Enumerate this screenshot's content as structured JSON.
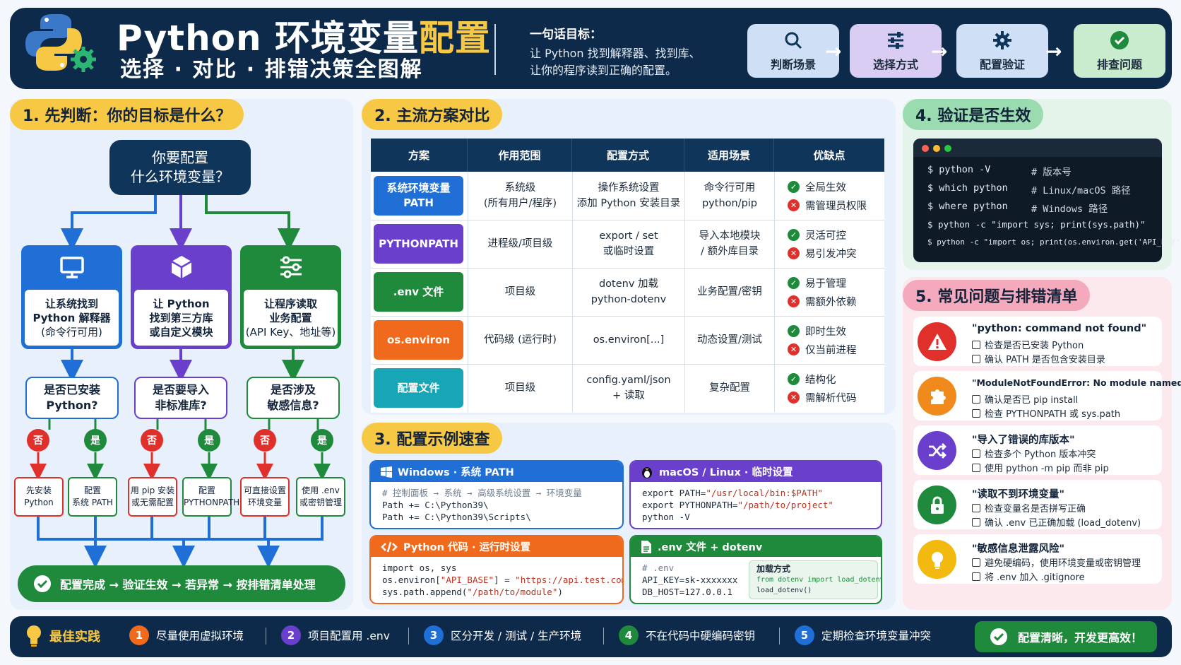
{
  "header": {
    "title_main": "Python 环境变量",
    "title_highlight": "配置",
    "subtitle": "选择 · 对比 · 排错决策全图解",
    "goal_title": "一句话目标：",
    "goal_lines": [
      "让 Python 找到解释器、找到库、",
      "让你的程序读到正确的配置。"
    ],
    "steps": [
      "判断场景",
      "选择方式",
      "配置验证",
      "排查问题"
    ],
    "arrow": "→"
  },
  "section1": {
    "title": "1. 先判断：你的目标是什么？",
    "root": [
      "你要配置",
      "什么环境变量？"
    ],
    "goals": [
      {
        "l1": "让系统找到",
        "l2": "Python 解释器",
        "l3": "(命令行可用)"
      },
      {
        "l1": "让 Python",
        "l2": "找到第三方库",
        "l3": "或自定义模块"
      },
      {
        "l1": "让程序读取",
        "l2": "业务配置",
        "l3": "(API Key、地址等)"
      }
    ],
    "questions": [
      [
        "是否已安装",
        "Python?"
      ],
      [
        "是否要导入",
        "非标准库?"
      ],
      [
        "是否涉及",
        "敏感信息?"
      ]
    ],
    "no": "否",
    "yes": "是",
    "leaves": [
      [
        "先安装",
        "Python"
      ],
      [
        "配置",
        "系统 PATH"
      ],
      [
        "用 pip 安装",
        "或无需配置"
      ],
      [
        "配置",
        "PYTHONPATH"
      ],
      [
        "可直接设置",
        "环境变量"
      ],
      [
        "使用 .env",
        "或密钥管理"
      ]
    ],
    "final": "配置完成 → 验证生效 → 若异常 → 按排错清单处理"
  },
  "section2": {
    "title": "2. 主流方案对比",
    "headers": [
      "方案",
      "作用范围",
      "配置方式",
      "适用场景",
      "优缺点"
    ],
    "rows": [
      {
        "tag1": "系统环境变量",
        "tag2": "PATH",
        "scope1": "系统级",
        "scope2": "(所有用户/程序)",
        "method1": "操作系统设置",
        "method2": "添加 Python 安装目录",
        "use1": "命令行可用",
        "use2": "python/pip",
        "pro": "全局生效",
        "con": "需管理员权限",
        "color": "#1f6fd6"
      },
      {
        "tag1": "PYTHONPATH",
        "tag2": "",
        "scope1": "进程级/项目级",
        "scope2": "",
        "method1": "export / set",
        "method2": "或临时设置",
        "use1": "导入本地模块",
        "use2": "/ 额外库目录",
        "pro": "灵活可控",
        "con": "易引发冲突",
        "color": "#6a3fcb"
      },
      {
        "tag1": ".env 文件",
        "tag2": "",
        "scope1": "项目级",
        "scope2": "",
        "method1": "dotenv 加载",
        "method2": "python-dotenv",
        "use1": "业务配置/密钥",
        "use2": "",
        "pro": "易于管理",
        "con": "需额外依赖",
        "color": "#1f8a3c"
      },
      {
        "tag1": "os.environ",
        "tag2": "",
        "scope1": "代码级 (运行时)",
        "scope2": "",
        "method1": "os.environ[...]",
        "method2": "",
        "use1": "动态设置/测试",
        "use2": "",
        "pro": "即时生效",
        "con": "仅当前进程",
        "color": "#ef6a1c"
      },
      {
        "tag1": "配置文件",
        "tag2": "",
        "scope1": "项目级",
        "scope2": "",
        "method1": "config.yaml/json",
        "method2": "+ 读取",
        "use1": "复杂配置",
        "use2": "",
        "pro": "结构化",
        "con": "需解析代码",
        "color": "#16a6b6"
      }
    ]
  },
  "section3": {
    "title": "3. 配置示例速查",
    "cards": [
      {
        "header": "Windows · 系统 PATH",
        "color": "#1f6fd6"
      },
      {
        "header": "macOS / Linux · 临时设置",
        "color": "#6a3fcb"
      },
      {
        "header": "Python 代码 · 运行时设置",
        "color": "#ef6a1c"
      },
      {
        "header": ".env 文件 + dotenv",
        "color": "#1f8a3c"
      }
    ],
    "win": {
      "comment": "# 控制面板 → 系统 → 高级系统设置 → 环境变量",
      "l1": "Path += C:\\Python39\\",
      "l2": "Path += C:\\Python39\\Scripts\\"
    },
    "mac": {
      "l1a": "export PATH=",
      "l1b": "\"/usr/local/bin:$PATH\"",
      "l2a": "export PYTHONPATH=",
      "l2b": "\"/path/to/project\"",
      "l3": "python -V"
    },
    "py": {
      "l1": "import os, sys",
      "l2a": "os.environ[",
      "l2b": "\"API_BASE\"",
      "l2c": "] = ",
      "l2d": "\"https://api.test.com\"",
      "l3a": "sys.path.append(",
      "l3b": "\"/path/to/module\"",
      "l3c": ")"
    },
    "env": {
      "comment": "# .env",
      "l1": "API_KEY=sk-xxxxxxx",
      "l2": "DB_HOST=127.0.0.1",
      "load_title": "加载方式",
      "load_l1": "from dotenv import load_dotenv",
      "load_l2": "load_dotenv()"
    }
  },
  "section4": {
    "title": "4. 验证是否生效",
    "cmds": [
      {
        "cmd": "$ python -V",
        "comment": "# 版本号"
      },
      {
        "cmd": "$ which python",
        "comment": "# Linux/macOS 路径"
      },
      {
        "cmd": "$ where python",
        "comment": "# Windows 路径"
      },
      {
        "cmd": "$ python -c \"import sys; print(sys.path)\"",
        "comment": ""
      },
      {
        "cmd": "$ python -c \"import os; print(os.environ.get('API_KEY'))\"",
        "comment": ""
      }
    ]
  },
  "section5": {
    "title": "5. 常见问题与排错清单",
    "problems": [
      {
        "title": "\"python: command not found\"",
        "i1": "检查是否已安装 Python",
        "i2": "确认 PATH 是否包含安装目录",
        "color": "#e0302b"
      },
      {
        "title": "\"ModuleNotFoundError: No module named ...\"",
        "i1": "确认是否已 pip install",
        "i2": "检查 PYTHONPATH 或 sys.path",
        "color": "#f08a1c"
      },
      {
        "title": "\"导入了错误的库版本\"",
        "i1": "检查多个 Python 版本冲突",
        "i2": "使用 python -m pip 而非 pip",
        "color": "#6a3fcb"
      },
      {
        "title": "\"读取不到环境变量\"",
        "i1": "检查变量名是否拼写正确",
        "i2": "确认 .env 已正确加载 (load_dotenv)",
        "color": "#1f8a3c"
      },
      {
        "title": "\"敏感信息泄露风险\"",
        "i1": "避免硬编码，使用环境变量或密钥管理",
        "i2": "将 .env 加入 .gitignore",
        "color": "#f2b90f"
      }
    ]
  },
  "footer": {
    "label": "最佳实践",
    "items": [
      "尽量使用虚拟环境",
      "项目配置用 .env",
      "区分开发 / 测试 / 生产环境",
      "不在代码中硬编码密钥",
      "定期检查环境变量冲突"
    ],
    "nums": [
      "1",
      "2",
      "3",
      "4",
      "5"
    ],
    "num_colors": [
      "#ef6a1c",
      "#6a3fcb",
      "#1f6fd6",
      "#1f8a3c",
      "#1f6fd6"
    ],
    "end": "配置清晰，开发更高效！"
  }
}
